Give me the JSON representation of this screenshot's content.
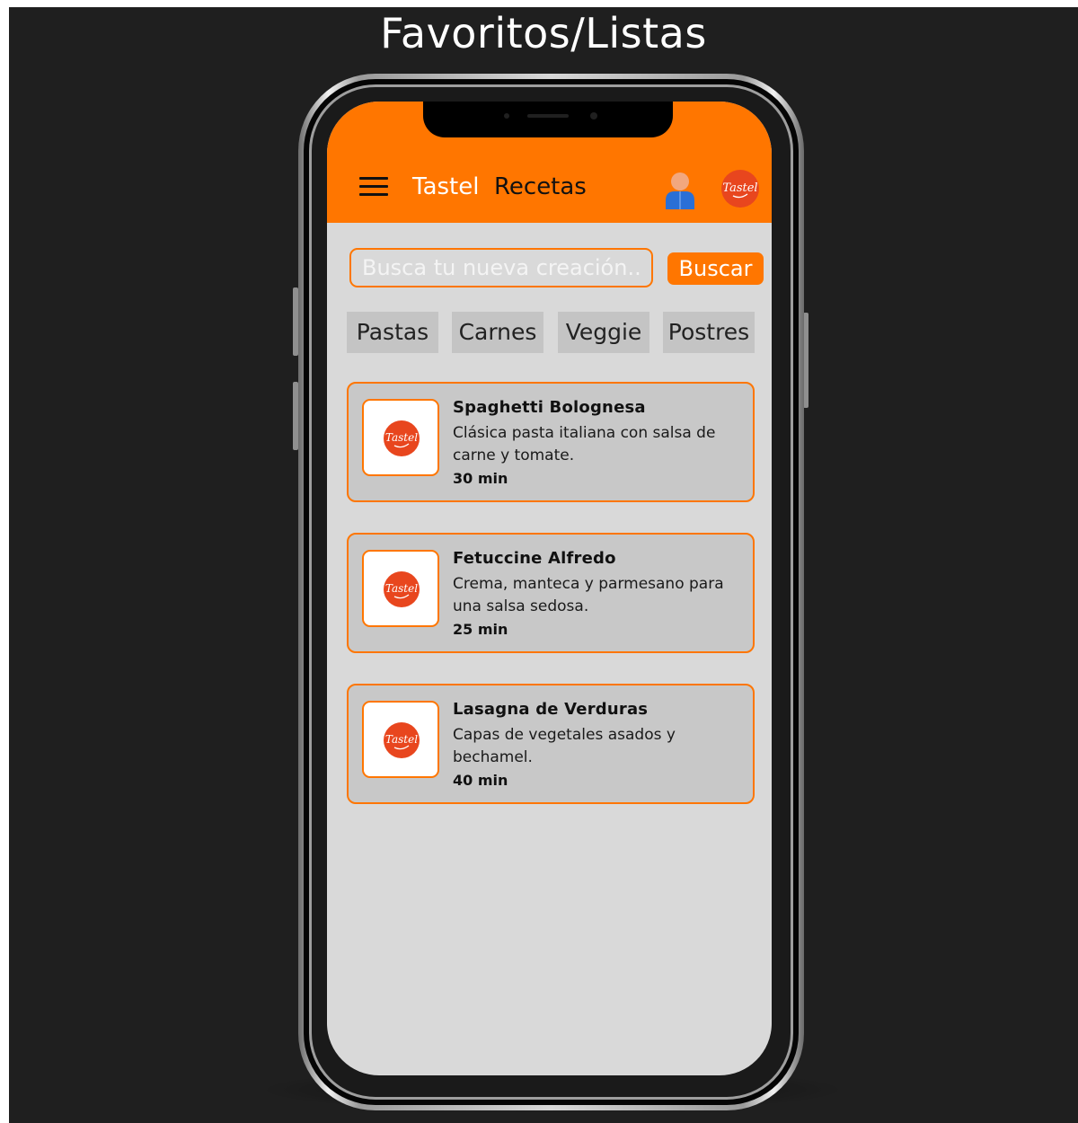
{
  "page_heading": "Favoritos/Listas",
  "header": {
    "brand": "Tastel",
    "section": "Recetas",
    "menu_icon": "hamburger-menu-icon",
    "user_icon": "user-profile-icon",
    "logo": "tastel-logo",
    "logo_text": "Tastel"
  },
  "search": {
    "value": "",
    "placeholder": "Busca tu nueva creación...",
    "button_label": "Buscar"
  },
  "categories": [
    "Pastas",
    "Carnes",
    "Veggie",
    "Postres"
  ],
  "recipes": [
    {
      "title": "Spaghetti Bolognesa",
      "description": "Clásica pasta italiana con salsa de carne y tomate.",
      "time": "30 min",
      "logo_text": "Tastel"
    },
    {
      "title": "Fetuccine Alfredo",
      "description": "Crema, manteca y parmesano para una salsa sedosa.",
      "time": "25 min",
      "logo_text": "Tastel"
    },
    {
      "title": "Lasagna de Verduras",
      "description": "Capas de vegetales asados y bechamel.",
      "time": "40 min",
      "logo_text": "Tastel"
    }
  ],
  "colors": {
    "accent": "#ff7600",
    "screen_background": "#d9d9d9",
    "card_background": "#c8c8c8",
    "chip_background": "#c4c4c4",
    "page_background": "#1f1f1f",
    "logo_red": "#e8461e"
  }
}
